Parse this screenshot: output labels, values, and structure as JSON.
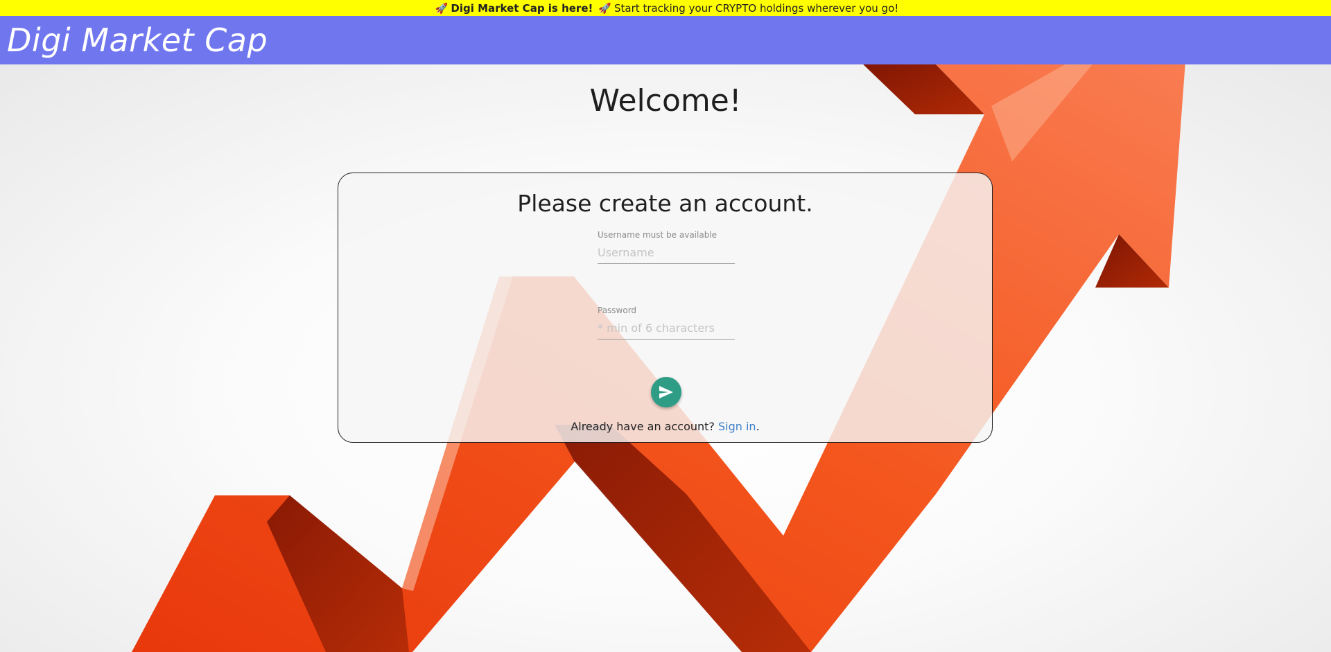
{
  "banner": {
    "rocket_left": "🚀",
    "headline": "Digi Market Cap is here!",
    "rocket_right": "🚀",
    "message": "Start tracking your CRYPTO holdings wherever you go!",
    "color": "#ffff00"
  },
  "header": {
    "brand": "Digi Market Cap",
    "color": "#7076ee"
  },
  "main": {
    "welcome": "Welcome!"
  },
  "signup": {
    "title": "Please create an account.",
    "username": {
      "label": "Username must be available",
      "placeholder": "Username",
      "value": ""
    },
    "password": {
      "label": "Password",
      "placeholder": "* min of 6 characters",
      "value": ""
    },
    "submit_icon": "send-icon",
    "submit_color": "#2f9d86",
    "footer_prefix": "Already have an account?",
    "footer_link": "Sign in",
    "footer_suffix": ".",
    "link_color": "#3d7ec8"
  }
}
